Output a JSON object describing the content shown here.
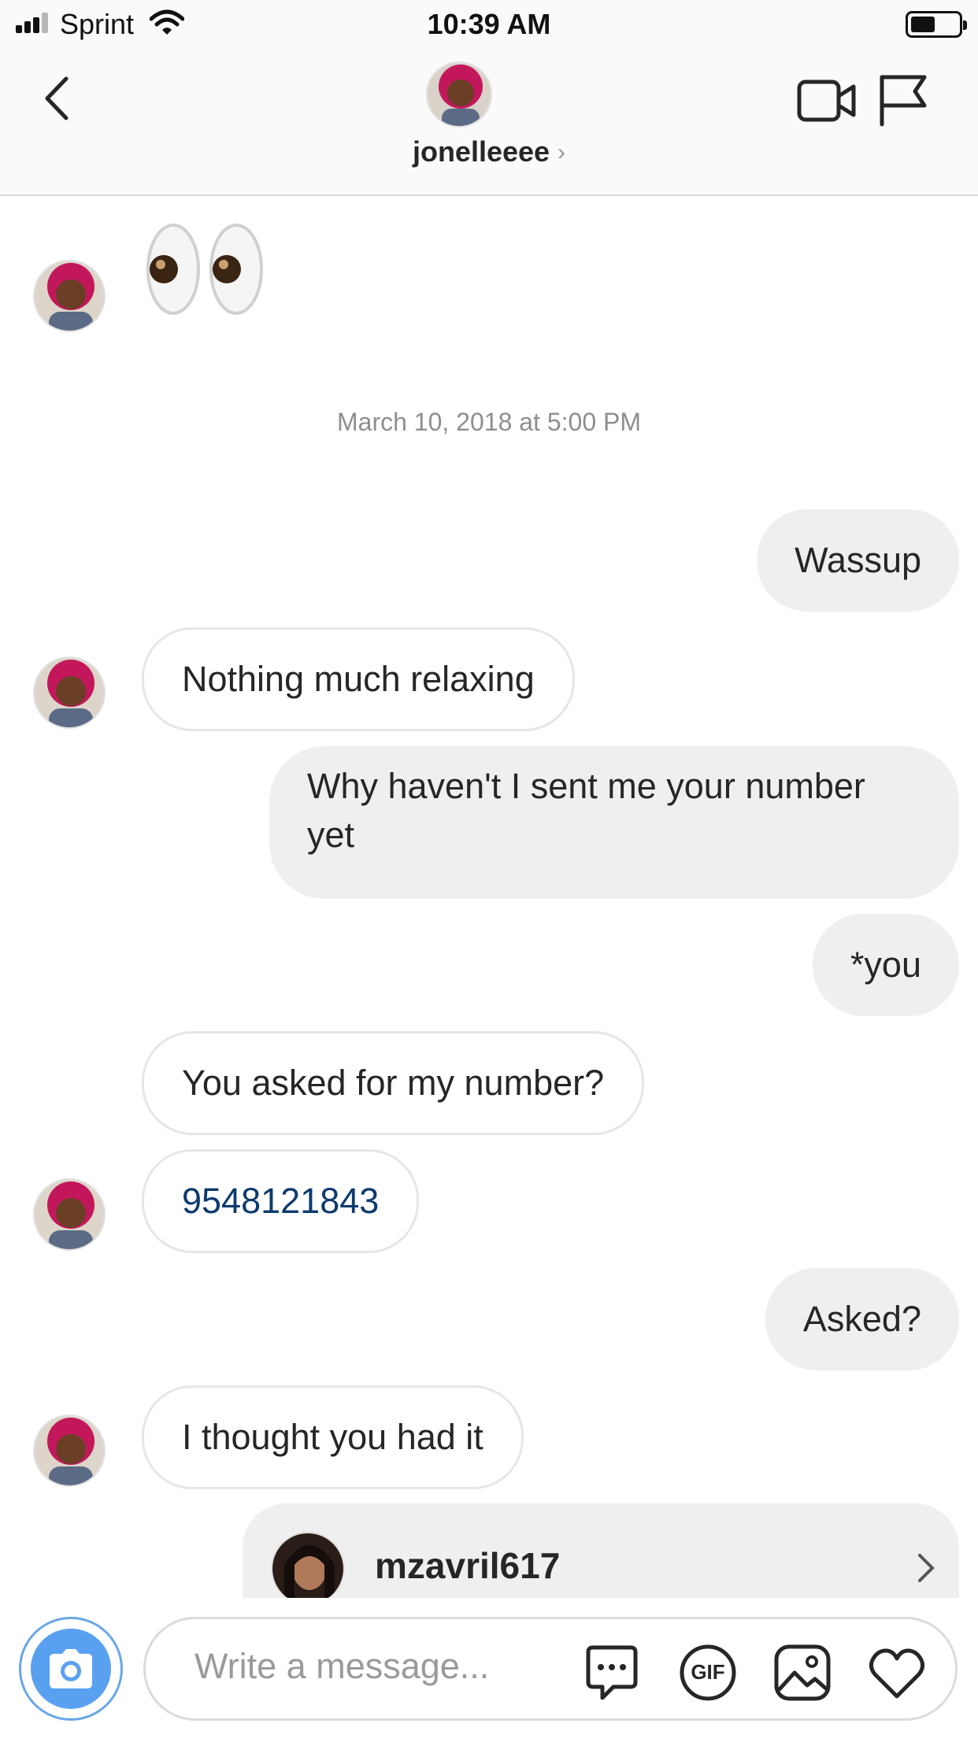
{
  "status_bar": {
    "carrier": "Sprint",
    "time": "10:39 AM",
    "battery_level": 0.45
  },
  "header": {
    "username": "jonelleeee",
    "back_icon": "chevron-left-icon",
    "video_icon": "video-camera-icon",
    "flag_icon": "flag-icon"
  },
  "messages": {
    "emoji": "👀",
    "timestamp": "March 10, 2018 at 5:00 PM",
    "m1": "Wassup",
    "m2": "Nothing much relaxing",
    "m3": "Why haven't I sent me your number yet",
    "m4": "*you",
    "m5": "You asked for my number?",
    "m6": "9548121843",
    "m7": "Asked?",
    "m8": "I thought you had it"
  },
  "shared_post": {
    "username": "mzavril617"
  },
  "composer": {
    "placeholder": "Write a message...",
    "gif_label": "GIF",
    "icons": [
      "camera-icon",
      "chat-bubble-icon",
      "gif-icon",
      "photo-icon",
      "heart-icon"
    ]
  },
  "colors": {
    "accent_blue": "#5aa0f0",
    "link_blue": "#0d3a6f",
    "outgoing_bubble": "#efefef",
    "incoming_border": "#e6e6e6"
  }
}
